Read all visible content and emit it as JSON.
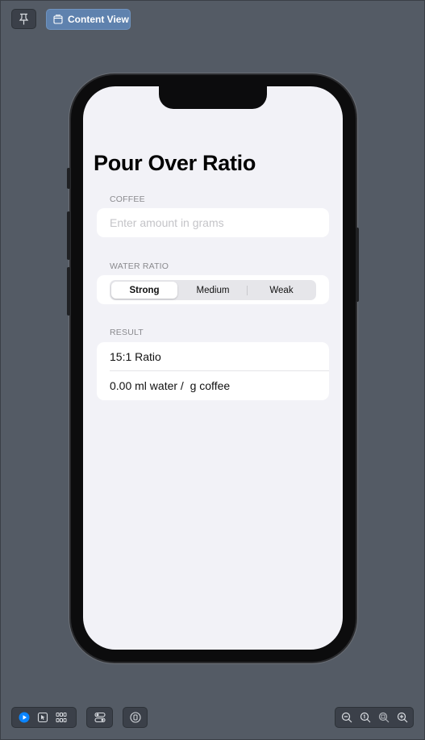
{
  "toolbar": {
    "content_view_label": "Content View"
  },
  "app": {
    "title": "Pour Over Ratio",
    "coffee": {
      "section_label": "COFFEE",
      "placeholder": "Enter amount in grams",
      "value": ""
    },
    "water_ratio": {
      "section_label": "WATER RATIO",
      "options": [
        "Strong",
        "Medium",
        "Weak"
      ],
      "selected": "Strong"
    },
    "result": {
      "section_label": "RESULT",
      "ratio_text": "15:1 Ratio",
      "water_text": "0.00 ml water /  g coffee"
    }
  },
  "colors": {
    "canvas_bg": "#545b65",
    "accent": "#5f82ae",
    "screen_bg": "#f2f2f7",
    "live_icon": "#0a84ff"
  },
  "icons": {
    "pin": "pin-icon",
    "content_view": "window-icon",
    "live": "play-circle-icon",
    "select": "cursor-icon",
    "variants": "grid-icon",
    "device_settings": "toggles-icon",
    "preview_settings": "info-circle-icon",
    "zoom_out": "zoom-out-icon",
    "zoom_100": "zoom-actual-icon",
    "zoom_fit": "zoom-fit-icon",
    "zoom_in": "zoom-in-icon"
  }
}
